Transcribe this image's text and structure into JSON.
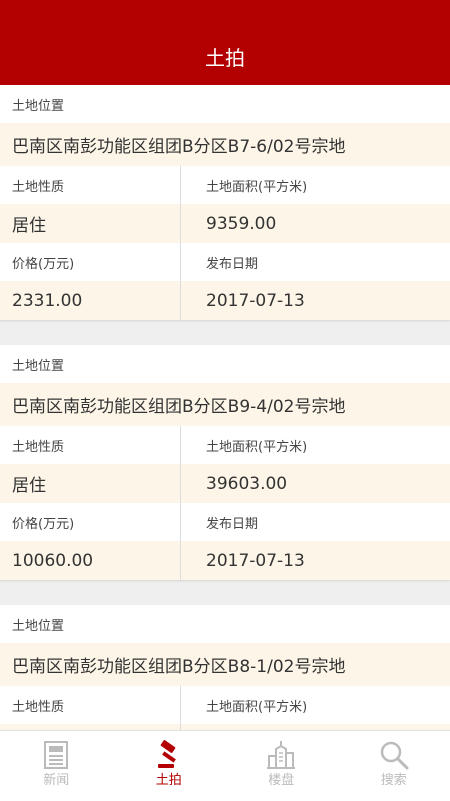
{
  "header": {
    "title": "土拍"
  },
  "cards": [
    {
      "location_label": "土地位置",
      "location": "巴南区南彭功能区组团B分区B7-6/02号宗地",
      "nature_label": "土地性质",
      "nature": "居住",
      "area_label": "土地面积(平方米)",
      "area": "9359.00",
      "price_label": "价格(万元)",
      "price": "2331.00",
      "date_label": "发布日期",
      "date": "2017-07-13"
    },
    {
      "location_label": "土地位置",
      "location": "巴南区南彭功能区组团B分区B9-4/02号宗地",
      "nature_label": "土地性质",
      "nature": "居住",
      "area_label": "土地面积(平方米)",
      "area": "39603.00",
      "price_label": "价格(万元)",
      "price": "10060.00",
      "date_label": "发布日期",
      "date": "2017-07-13"
    },
    {
      "location_label": "土地位置",
      "location": "巴南区南彭功能区组团B分区B8-1/02号宗地",
      "nature_label": "土地性质",
      "nature_label_only": true,
      "area_label": "土地面积(平方米)"
    }
  ],
  "tabbar": {
    "items": [
      {
        "label": "新闻",
        "icon": "newspaper-icon",
        "active": false
      },
      {
        "label": "土拍",
        "icon": "gavel-icon",
        "active": true
      },
      {
        "label": "楼盘",
        "icon": "building-icon",
        "active": false
      },
      {
        "label": "搜索",
        "icon": "search-icon",
        "active": false
      }
    ]
  },
  "colors": {
    "brand": "#b30000",
    "value_row_bg": "#fdf6e8",
    "inactive_tab": "#bbbbbb"
  }
}
